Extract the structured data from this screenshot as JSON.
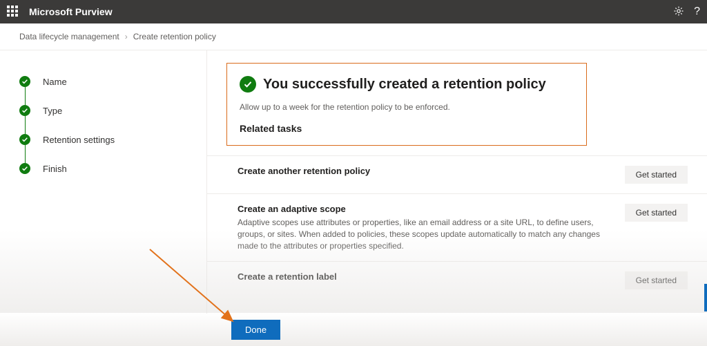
{
  "topbar": {
    "app_title": "Microsoft Purview"
  },
  "breadcrumbs": {
    "items": [
      "Data lifecycle management",
      "Create retention policy"
    ]
  },
  "steps": [
    {
      "label": "Name"
    },
    {
      "label": "Type"
    },
    {
      "label": "Retention settings"
    },
    {
      "label": "Finish"
    }
  ],
  "success": {
    "title": "You successfully created a retention policy",
    "subtitle": "Allow up to a week for the retention policy to be enforced.",
    "related_heading": "Related tasks"
  },
  "tasks": [
    {
      "title": "Create another retention policy",
      "desc": "",
      "button": "Get started"
    },
    {
      "title": "Create an adaptive scope",
      "desc": "Adaptive scopes use attributes or properties, like an email address or a site URL, to define users, groups, or sites. When added to policies, these scopes update automatically to match any changes made to the attributes or properties specified.",
      "button": "Get started"
    },
    {
      "title": "Create a retention label",
      "desc": "",
      "button": "Get started"
    }
  ],
  "footer": {
    "done": "Done"
  }
}
